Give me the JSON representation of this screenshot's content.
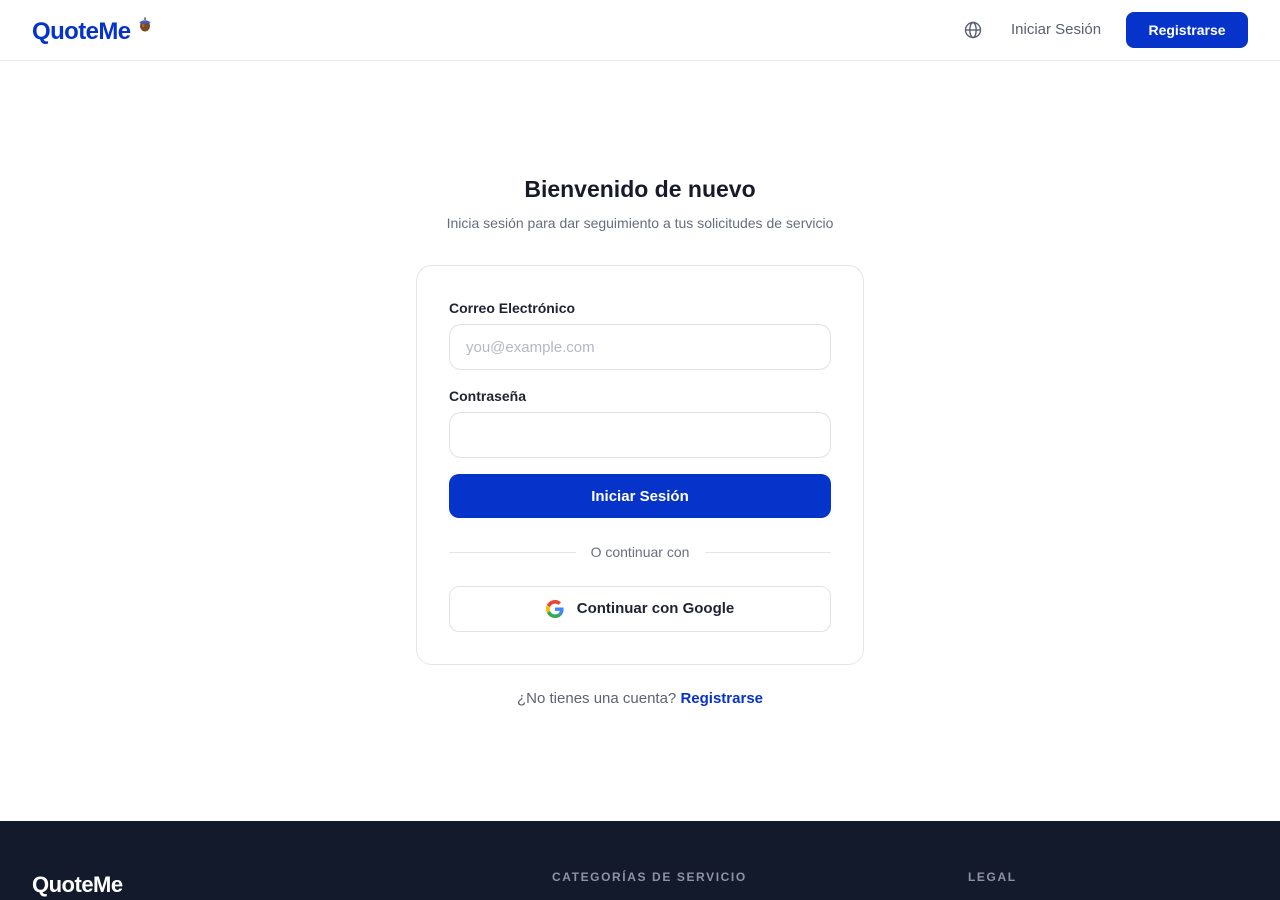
{
  "header": {
    "brand": "QuoteMe",
    "nav": {
      "language_icon": "globe-icon",
      "login_label": "Iniciar Sesión",
      "register_label": "Registrarse"
    }
  },
  "main": {
    "title": "Bienvenido de nuevo",
    "subtitle": "Inicia sesión para dar seguimiento a tus solicitudes de servicio",
    "form": {
      "email_label": "Correo Electrónico",
      "email_value": "",
      "email_placeholder": "you@example.com",
      "password_label": "Contraseña",
      "password_value": "",
      "submit_label": "Iniciar Sesión",
      "divider_text": "O continuar con",
      "google_label": "Continuar con Google",
      "google_icon": "google-icon"
    },
    "signup": {
      "prompt": "¿No tienes una cuenta?",
      "link": "Registrarse"
    }
  },
  "footer": {
    "brand": "QuoteMe",
    "columns": {
      "services_heading": "CATEGORÍAS DE SERVICIO",
      "legal_heading": "LEGAL"
    }
  },
  "colors": {
    "brand": "#0633c9",
    "footer_bg": "#131a2b",
    "text_dark": "#1e2233",
    "text_muted": "#676d7e",
    "border": "#e4e6ec"
  }
}
